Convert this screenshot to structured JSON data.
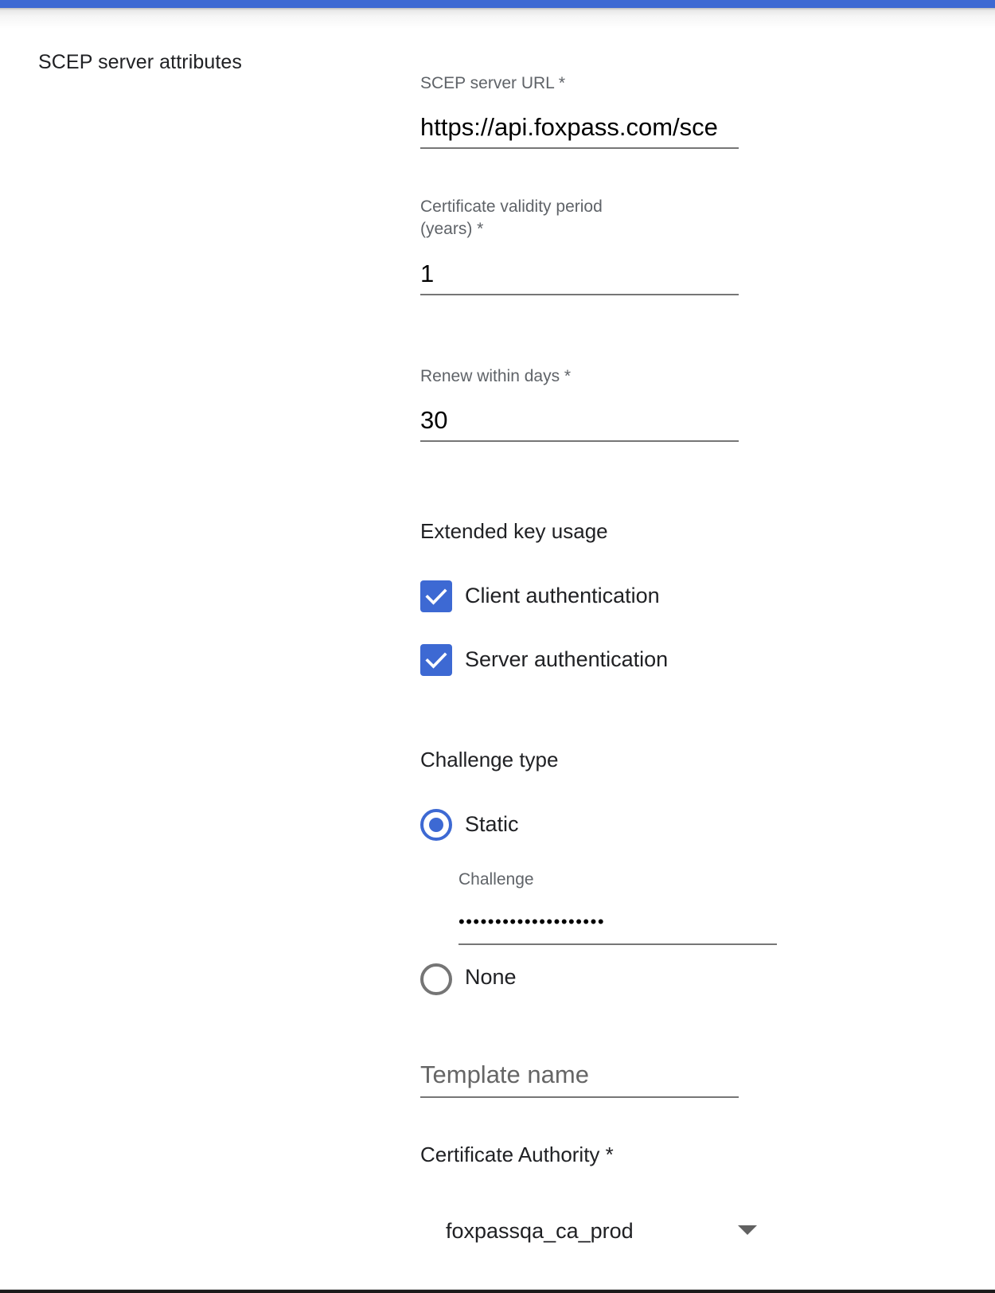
{
  "colors": {
    "accent": "#3d69d3",
    "label": "#5f6368",
    "underline": "#767676"
  },
  "section": {
    "title": "SCEP server attributes"
  },
  "fields": {
    "scep_url": {
      "label": "SCEP server URL *",
      "value": "https://api.foxpass.com/sce"
    },
    "validity": {
      "label_line1": "Certificate validity period",
      "label_line2": "(years) *",
      "value": "1"
    },
    "renew": {
      "label": "Renew within days *",
      "value": "30"
    }
  },
  "extended_key_usage": {
    "heading": "Extended key usage",
    "options": [
      {
        "label": "Client authentication",
        "checked": true
      },
      {
        "label": "Server authentication",
        "checked": true
      }
    ]
  },
  "challenge_type": {
    "heading": "Challenge type",
    "options": [
      {
        "label": "Static",
        "selected": true
      },
      {
        "label": "None",
        "selected": false
      }
    ],
    "challenge": {
      "label": "Challenge",
      "masked_value": "••••••••••••••••••••"
    }
  },
  "template_name": {
    "placeholder": "Template name",
    "value": ""
  },
  "certificate_authority": {
    "label": "Certificate Authority *",
    "selected": "foxpassqa_ca_prod",
    "icon": "caret-down-icon"
  }
}
